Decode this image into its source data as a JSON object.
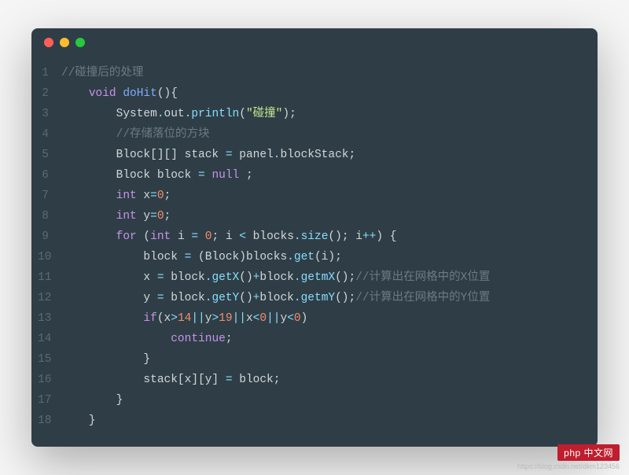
{
  "window": {
    "dots": [
      "red",
      "yellow",
      "green"
    ]
  },
  "code": {
    "start_line": 1,
    "lines": [
      [
        {
          "t": "//碰撞后的处理",
          "c": "comment"
        }
      ],
      [
        {
          "t": "    ",
          "c": "plain"
        },
        {
          "t": "void",
          "c": "keyword"
        },
        {
          "t": " ",
          "c": "plain"
        },
        {
          "t": "doHit",
          "c": "method"
        },
        {
          "t": "(){",
          "c": "punc"
        }
      ],
      [
        {
          "t": "        System",
          "c": "plain"
        },
        {
          "t": ".",
          "c": "op"
        },
        {
          "t": "out",
          "c": "plain"
        },
        {
          "t": ".",
          "c": "op"
        },
        {
          "t": "println",
          "c": "call"
        },
        {
          "t": "(",
          "c": "punc"
        },
        {
          "t": "\"碰撞\"",
          "c": "string"
        },
        {
          "t": ");",
          "c": "punc"
        }
      ],
      [
        {
          "t": "        ",
          "c": "plain"
        },
        {
          "t": "//存储落位的方块",
          "c": "comment"
        }
      ],
      [
        {
          "t": "        Block[][] stack ",
          "c": "plain"
        },
        {
          "t": "=",
          "c": "op"
        },
        {
          "t": " panel",
          "c": "plain"
        },
        {
          "t": ".",
          "c": "op"
        },
        {
          "t": "blockStack;",
          "c": "plain"
        }
      ],
      [
        {
          "t": "        Block block ",
          "c": "plain"
        },
        {
          "t": "=",
          "c": "op"
        },
        {
          "t": " ",
          "c": "plain"
        },
        {
          "t": "null",
          "c": "literal"
        },
        {
          "t": " ;",
          "c": "punc"
        }
      ],
      [
        {
          "t": "        ",
          "c": "plain"
        },
        {
          "t": "int",
          "c": "keyword"
        },
        {
          "t": " x",
          "c": "plain"
        },
        {
          "t": "=",
          "c": "op"
        },
        {
          "t": "0",
          "c": "number"
        },
        {
          "t": ";",
          "c": "punc"
        }
      ],
      [
        {
          "t": "        ",
          "c": "plain"
        },
        {
          "t": "int",
          "c": "keyword"
        },
        {
          "t": " y",
          "c": "plain"
        },
        {
          "t": "=",
          "c": "op"
        },
        {
          "t": "0",
          "c": "number"
        },
        {
          "t": ";",
          "c": "punc"
        }
      ],
      [
        {
          "t": "        ",
          "c": "plain"
        },
        {
          "t": "for",
          "c": "keyword"
        },
        {
          "t": " (",
          "c": "punc"
        },
        {
          "t": "int",
          "c": "keyword"
        },
        {
          "t": " i ",
          "c": "plain"
        },
        {
          "t": "=",
          "c": "op"
        },
        {
          "t": " ",
          "c": "plain"
        },
        {
          "t": "0",
          "c": "number"
        },
        {
          "t": "; i ",
          "c": "plain"
        },
        {
          "t": "<",
          "c": "op"
        },
        {
          "t": " blocks",
          "c": "plain"
        },
        {
          "t": ".",
          "c": "op"
        },
        {
          "t": "size",
          "c": "call"
        },
        {
          "t": "(); i",
          "c": "plain"
        },
        {
          "t": "++",
          "c": "op"
        },
        {
          "t": ") {",
          "c": "punc"
        }
      ],
      [
        {
          "t": "            block ",
          "c": "plain"
        },
        {
          "t": "=",
          "c": "op"
        },
        {
          "t": " (Block)blocks",
          "c": "plain"
        },
        {
          "t": ".",
          "c": "op"
        },
        {
          "t": "get",
          "c": "call"
        },
        {
          "t": "(i);",
          "c": "punc"
        }
      ],
      [
        {
          "t": "            x ",
          "c": "plain"
        },
        {
          "t": "=",
          "c": "op"
        },
        {
          "t": " block",
          "c": "plain"
        },
        {
          "t": ".",
          "c": "op"
        },
        {
          "t": "getX",
          "c": "call"
        },
        {
          "t": "()",
          "c": "punc"
        },
        {
          "t": "+",
          "c": "op"
        },
        {
          "t": "block",
          "c": "plain"
        },
        {
          "t": ".",
          "c": "op"
        },
        {
          "t": "getmX",
          "c": "call"
        },
        {
          "t": "();",
          "c": "punc"
        },
        {
          "t": "//计算出在网格中的X位置",
          "c": "comment"
        }
      ],
      [
        {
          "t": "            y ",
          "c": "plain"
        },
        {
          "t": "=",
          "c": "op"
        },
        {
          "t": " block",
          "c": "plain"
        },
        {
          "t": ".",
          "c": "op"
        },
        {
          "t": "getY",
          "c": "call"
        },
        {
          "t": "()",
          "c": "punc"
        },
        {
          "t": "+",
          "c": "op"
        },
        {
          "t": "block",
          "c": "plain"
        },
        {
          "t": ".",
          "c": "op"
        },
        {
          "t": "getmY",
          "c": "call"
        },
        {
          "t": "();",
          "c": "punc"
        },
        {
          "t": "//计算出在网格中的Y位置",
          "c": "comment"
        }
      ],
      [
        {
          "t": "            ",
          "c": "plain"
        },
        {
          "t": "if",
          "c": "keyword"
        },
        {
          "t": "(x",
          "c": "plain"
        },
        {
          "t": ">",
          "c": "op"
        },
        {
          "t": "14",
          "c": "number"
        },
        {
          "t": "||",
          "c": "op"
        },
        {
          "t": "y",
          "c": "plain"
        },
        {
          "t": ">",
          "c": "op"
        },
        {
          "t": "19",
          "c": "number"
        },
        {
          "t": "||",
          "c": "op"
        },
        {
          "t": "x",
          "c": "plain"
        },
        {
          "t": "<",
          "c": "op"
        },
        {
          "t": "0",
          "c": "number"
        },
        {
          "t": "||",
          "c": "op"
        },
        {
          "t": "y",
          "c": "plain"
        },
        {
          "t": "<",
          "c": "op"
        },
        {
          "t": "0",
          "c": "number"
        },
        {
          "t": ")",
          "c": "punc"
        }
      ],
      [
        {
          "t": "                ",
          "c": "plain"
        },
        {
          "t": "continue",
          "c": "keyword"
        },
        {
          "t": ";",
          "c": "punc"
        }
      ],
      [
        {
          "t": "            }",
          "c": "punc"
        }
      ],
      [
        {
          "t": "            stack[x][y] ",
          "c": "plain"
        },
        {
          "t": "=",
          "c": "op"
        },
        {
          "t": " block;",
          "c": "plain"
        }
      ],
      [
        {
          "t": "        }",
          "c": "punc"
        }
      ],
      [
        {
          "t": "    }",
          "c": "punc"
        }
      ]
    ]
  },
  "watermark": {
    "badge": "php 中文网",
    "url": "https://blog.csdn.net/dkm123456"
  }
}
